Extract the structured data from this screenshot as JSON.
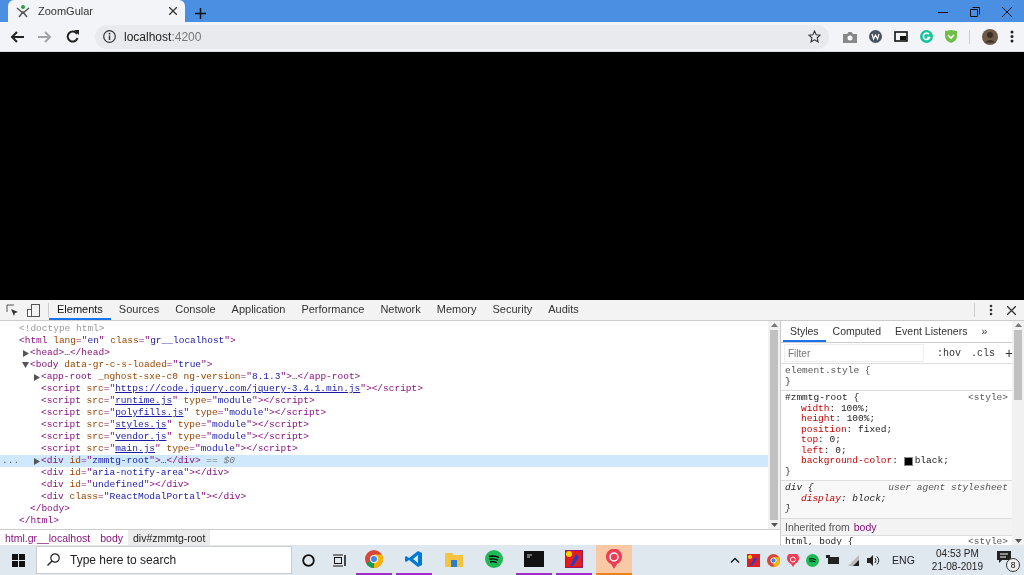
{
  "browser": {
    "tab": {
      "title": "ZoomGular",
      "selected": true
    },
    "address": {
      "host": "localhost",
      "port": ":4200"
    },
    "forward_disabled": true
  },
  "devtools": {
    "tabs": [
      {
        "label": "Elements",
        "selected": true
      },
      {
        "label": "Sources",
        "selected": false
      },
      {
        "label": "Console",
        "selected": false
      },
      {
        "label": "Application",
        "selected": false
      },
      {
        "label": "Performance",
        "selected": false
      },
      {
        "label": "Network",
        "selected": false
      },
      {
        "label": "Memory",
        "selected": false
      },
      {
        "label": "Security",
        "selected": false
      },
      {
        "label": "Audits",
        "selected": false
      }
    ],
    "tree": [
      {
        "selected": false,
        "parts": [
          {
            "kind": "comment",
            "t": "<!doctype html>"
          }
        ]
      },
      {
        "selected": false,
        "parts": [
          {
            "kind": "tag",
            "t": "<html "
          },
          {
            "kind": "attr",
            "t": "lang"
          },
          {
            "kind": "tag",
            "t": "=\""
          },
          {
            "kind": "val",
            "t": "en"
          },
          {
            "kind": "tag",
            "t": "\" "
          },
          {
            "kind": "attr",
            "t": "class"
          },
          {
            "kind": "tag",
            "t": "=\""
          },
          {
            "kind": "val",
            "t": "gr__localhost"
          },
          {
            "kind": "tag",
            "t": "\">"
          }
        ],
        "close": [
          {
            "kind": "tag",
            "t": "</html>"
          }
        ],
        "children": [
          {
            "selected": false,
            "expanded": false,
            "parts": [
              {
                "kind": "tag",
                "t": "<head>"
              },
              {
                "kind": "plain",
                "t": "…"
              },
              {
                "kind": "tag",
                "t": "</head>"
              }
            ]
          },
          {
            "selected": false,
            "expanded": true,
            "parts": [
              {
                "kind": "tag",
                "t": "<body "
              },
              {
                "kind": "attr",
                "t": "data-gr-c-s-loaded"
              },
              {
                "kind": "tag",
                "t": "=\""
              },
              {
                "kind": "val",
                "t": "true"
              },
              {
                "kind": "tag",
                "t": "\">"
              }
            ],
            "close": [
              {
                "kind": "tag",
                "t": "</body>"
              }
            ],
            "children": [
              {
                "selected": false,
                "expanded": false,
                "parts": [
                  {
                    "kind": "tag",
                    "t": "<app-root "
                  },
                  {
                    "kind": "attr",
                    "t": "_nghost-sxe-c0 ng-version"
                  },
                  {
                    "kind": "tag",
                    "t": "=\""
                  },
                  {
                    "kind": "val",
                    "t": "8.1.3"
                  },
                  {
                    "kind": "tag",
                    "t": "\">"
                  },
                  {
                    "kind": "plain",
                    "t": "…"
                  },
                  {
                    "kind": "tag",
                    "t": "</app-root>"
                  }
                ]
              },
              {
                "selected": false,
                "parts": [
                  {
                    "kind": "tag",
                    "t": "<script "
                  },
                  {
                    "kind": "attr",
                    "t": "src"
                  },
                  {
                    "kind": "tag",
                    "t": "=\""
                  },
                  {
                    "kind": "link",
                    "t": "https://code.jquery.com/jquery-3.4.1.min.js"
                  },
                  {
                    "kind": "tag",
                    "t": "\"></script>"
                  }
                ]
              },
              {
                "selected": false,
                "parts": [
                  {
                    "kind": "tag",
                    "t": "<script "
                  },
                  {
                    "kind": "attr",
                    "t": "src"
                  },
                  {
                    "kind": "tag",
                    "t": "=\""
                  },
                  {
                    "kind": "link",
                    "t": "runtime.js"
                  },
                  {
                    "kind": "tag",
                    "t": "\" "
                  },
                  {
                    "kind": "attr",
                    "t": "type"
                  },
                  {
                    "kind": "tag",
                    "t": "=\""
                  },
                  {
                    "kind": "val",
                    "t": "module"
                  },
                  {
                    "kind": "tag",
                    "t": "\"></script>"
                  }
                ]
              },
              {
                "selected": false,
                "parts": [
                  {
                    "kind": "tag",
                    "t": "<script "
                  },
                  {
                    "kind": "attr",
                    "t": "src"
                  },
                  {
                    "kind": "tag",
                    "t": "=\""
                  },
                  {
                    "kind": "link",
                    "t": "polyfills.js"
                  },
                  {
                    "kind": "tag",
                    "t": "\" "
                  },
                  {
                    "kind": "attr",
                    "t": "type"
                  },
                  {
                    "kind": "tag",
                    "t": "=\""
                  },
                  {
                    "kind": "val",
                    "t": "module"
                  },
                  {
                    "kind": "tag",
                    "t": "\"></script>"
                  }
                ]
              },
              {
                "selected": false,
                "parts": [
                  {
                    "kind": "tag",
                    "t": "<script "
                  },
                  {
                    "kind": "attr",
                    "t": "src"
                  },
                  {
                    "kind": "tag",
                    "t": "=\""
                  },
                  {
                    "kind": "link",
                    "t": "styles.js"
                  },
                  {
                    "kind": "tag",
                    "t": "\" "
                  },
                  {
                    "kind": "attr",
                    "t": "type"
                  },
                  {
                    "kind": "tag",
                    "t": "=\""
                  },
                  {
                    "kind": "val",
                    "t": "module"
                  },
                  {
                    "kind": "tag",
                    "t": "\"></script>"
                  }
                ]
              },
              {
                "selected": false,
                "parts": [
                  {
                    "kind": "tag",
                    "t": "<script "
                  },
                  {
                    "kind": "attr",
                    "t": "src"
                  },
                  {
                    "kind": "tag",
                    "t": "=\""
                  },
                  {
                    "kind": "link",
                    "t": "vendor.js"
                  },
                  {
                    "kind": "tag",
                    "t": "\" "
                  },
                  {
                    "kind": "attr",
                    "t": "type"
                  },
                  {
                    "kind": "tag",
                    "t": "=\""
                  },
                  {
                    "kind": "val",
                    "t": "module"
                  },
                  {
                    "kind": "tag",
                    "t": "\"></script>"
                  }
                ]
              },
              {
                "selected": false,
                "parts": [
                  {
                    "kind": "tag",
                    "t": "<script "
                  },
                  {
                    "kind": "attr",
                    "t": "src"
                  },
                  {
                    "kind": "tag",
                    "t": "=\""
                  },
                  {
                    "kind": "link",
                    "t": "main.js"
                  },
                  {
                    "kind": "tag",
                    "t": "\" "
                  },
                  {
                    "kind": "attr",
                    "t": "type"
                  },
                  {
                    "kind": "tag",
                    "t": "=\""
                  },
                  {
                    "kind": "val",
                    "t": "module"
                  },
                  {
                    "kind": "tag",
                    "t": "\"></script>"
                  }
                ]
              },
              {
                "selected": true,
                "gutter": "...",
                "expanded": false,
                "parts": [
                  {
                    "kind": "tag",
                    "t": "<div "
                  },
                  {
                    "kind": "attr",
                    "t": "id"
                  },
                  {
                    "kind": "tag",
                    "t": "=\""
                  },
                  {
                    "kind": "val",
                    "t": "zmmtg-root"
                  },
                  {
                    "kind": "tag",
                    "t": "\">"
                  },
                  {
                    "kind": "plain",
                    "t": "…"
                  },
                  {
                    "kind": "tag",
                    "t": "</div>"
                  },
                  {
                    "kind": "hint",
                    "t": " == $0"
                  }
                ]
              },
              {
                "selected": false,
                "parts": [
                  {
                    "kind": "tag",
                    "t": "<div "
                  },
                  {
                    "kind": "attr",
                    "t": "id"
                  },
                  {
                    "kind": "tag",
                    "t": "=\""
                  },
                  {
                    "kind": "val",
                    "t": "aria-notify-area"
                  },
                  {
                    "kind": "tag",
                    "t": "\"></div>"
                  }
                ]
              },
              {
                "selected": false,
                "parts": [
                  {
                    "kind": "tag",
                    "t": "<div "
                  },
                  {
                    "kind": "attr",
                    "t": "id"
                  },
                  {
                    "kind": "tag",
                    "t": "=\""
                  },
                  {
                    "kind": "val",
                    "t": "undefined"
                  },
                  {
                    "kind": "tag",
                    "t": "\"></div>"
                  }
                ]
              },
              {
                "selected": false,
                "parts": [
                  {
                    "kind": "tag",
                    "t": "<div "
                  },
                  {
                    "kind": "attr",
                    "t": "class"
                  },
                  {
                    "kind": "tag",
                    "t": "=\""
                  },
                  {
                    "kind": "val",
                    "t": "ReactModalPortal"
                  },
                  {
                    "kind": "tag",
                    "t": "\"></div>"
                  }
                ]
              }
            ]
          }
        ]
      }
    ],
    "breadcrumbs": [
      {
        "label": "html.gr__localhost",
        "selected": false
      },
      {
        "label": "body",
        "selected": false
      },
      {
        "label": "div#zmmtg-root",
        "selected": true
      }
    ],
    "side_tabs": [
      {
        "label": "Styles",
        "selected": true
      },
      {
        "label": "Computed",
        "selected": false
      },
      {
        "label": "Event Listeners",
        "selected": false
      },
      {
        "label": "»",
        "selected": false
      }
    ],
    "filter": {
      "placeholder": "Filter"
    },
    "filter_buttons": [
      ":hov",
      ".cls",
      "+"
    ],
    "rules": [
      {
        "kind": "element",
        "selector": "element.style {",
        "close": "}"
      },
      {
        "kind": "author",
        "selector": "#zmmtg-root {",
        "source": "<style>",
        "close": "}",
        "properties": [
          {
            "name": "width",
            "sep": ": ",
            "value": "100%;"
          },
          {
            "name": "height",
            "sep": ": ",
            "value": "100%;"
          },
          {
            "name": "position",
            "sep": ": ",
            "value": "fixed;"
          },
          {
            "name": "top",
            "sep": ": ",
            "value": "0;"
          },
          {
            "name": "left",
            "sep": ": ",
            "value": "0;"
          },
          {
            "name": "background-color",
            "sep": ": ",
            "value": "black;",
            "color": "#000000"
          }
        ]
      },
      {
        "kind": "user-agent",
        "selector": "div {",
        "source": "user agent stylesheet",
        "close": "}",
        "properties": [
          {
            "name": "display",
            "sep": ": ",
            "value": "block;"
          }
        ]
      }
    ],
    "inherited": {
      "label": "Inherited from",
      "link": "body"
    },
    "partial_rule": {
      "selector": "html, body {",
      "source": "<style>"
    }
  },
  "taskbar": {
    "search": {
      "placeholder": "Type here to search"
    },
    "apps": [
      {
        "kind": "chrome",
        "running": true,
        "selected": false
      },
      {
        "kind": "vscode",
        "running": true,
        "selected": false
      },
      {
        "kind": "folder",
        "running": false,
        "selected": false
      },
      {
        "kind": "spotify",
        "running": false,
        "selected": false
      },
      {
        "kind": "terminal",
        "running": true,
        "selected": false
      },
      {
        "kind": "paint",
        "running": true,
        "selected": false
      },
      {
        "kind": "pin",
        "running": true,
        "selected": true
      }
    ],
    "language": "ENG",
    "time": "04:53 PM",
    "date": "21-08-2019",
    "notifications": "8"
  }
}
